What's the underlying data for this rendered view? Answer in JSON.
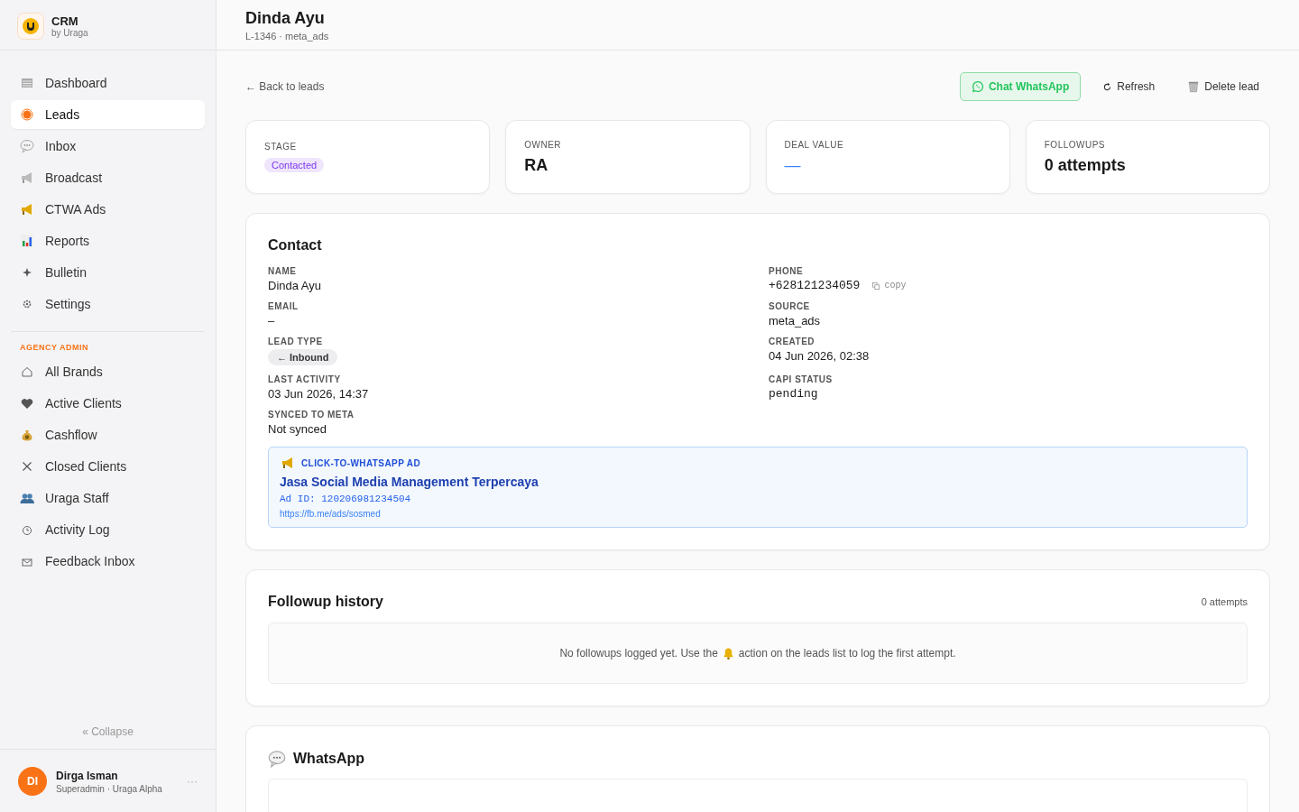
{
  "brand": {
    "name": "CRM",
    "subtitle": "by Uraga"
  },
  "nav": [
    {
      "label": "Dashboard",
      "selected": false
    },
    {
      "label": "Leads",
      "selected": true
    },
    {
      "label": "Inbox",
      "selected": false
    },
    {
      "label": "Broadcast",
      "selected": false
    },
    {
      "label": "CTWA Ads",
      "selected": false
    },
    {
      "label": "Reports",
      "selected": false
    },
    {
      "label": "Bulletin",
      "selected": false
    },
    {
      "label": "Settings",
      "selected": false
    }
  ],
  "admin_section": {
    "heading": "AGENCY ADMIN",
    "items": [
      {
        "label": "All Brands",
        "selected": false
      },
      {
        "label": "Active Clients",
        "selected": false
      },
      {
        "label": "Cashflow",
        "selected": false
      },
      {
        "label": "Closed Clients",
        "selected": false
      },
      {
        "label": "Uraga Staff",
        "selected": false
      },
      {
        "label": "Activity Log",
        "selected": false
      },
      {
        "label": "Feedback Inbox",
        "selected": false
      }
    ]
  },
  "collapse": "« Collapse",
  "user": {
    "initials": "DI",
    "name": "Dirga Isman",
    "role": "Superadmin · Uraga Alpha",
    "menu": "···"
  },
  "header": {
    "title": "Dinda Ayu",
    "subtitle": "L-1346 · meta_ads"
  },
  "back_link": "← Back to leads",
  "actions": [
    {
      "label": "Chat WhatsApp",
      "kind": "primary"
    },
    {
      "label": "Refresh",
      "kind": "refresh"
    },
    {
      "label": "Delete lead",
      "kind": "delete"
    }
  ],
  "stats": [
    {
      "label": "STAGE",
      "kind": "badge",
      "value": "Contacted"
    },
    {
      "label": "OWNER",
      "kind": "text",
      "value": "RA"
    },
    {
      "label": "DEAL VALUE",
      "kind": "empty",
      "value": "—"
    },
    {
      "label": "FOLLOWUPS",
      "kind": "text",
      "value": "0 attempts"
    }
  ],
  "contact": {
    "title": "Contact",
    "fields": [
      {
        "label": "NAME",
        "kind": "text",
        "value": "Dinda Ayu"
      },
      {
        "label": "PHONE",
        "kind": "phone",
        "value": "+628121234059",
        "action": "copy"
      },
      {
        "label": "EMAIL",
        "kind": "text",
        "value": "–"
      },
      {
        "label": "SOURCE",
        "kind": "text",
        "value": "meta_ads"
      },
      {
        "label": "LEAD TYPE",
        "kind": "pill",
        "value": "← Inbound"
      },
      {
        "label": "CREATED",
        "kind": "text",
        "value": "04 Jun 2026, 02:38"
      },
      {
        "label": "LAST ACTIVITY",
        "kind": "text",
        "value": "03 Jun 2026, 14:37"
      },
      {
        "label": "CAPI STATUS",
        "kind": "mono",
        "value": "pending"
      },
      {
        "label": "SYNCED TO META",
        "kind": "text",
        "value": "Not synced"
      }
    ]
  },
  "ad": {
    "heading": "CLICK-TO-WHATSAPP AD",
    "title": "Jasa Social Media Management Terpercaya",
    "ad_id": "Ad ID: 120206981234504",
    "url": "https://fb.me/ads/sosmed"
  },
  "followups": {
    "title": "Followup history",
    "count": "0 attempts",
    "empty_before": "No followups logged yet. Use the",
    "empty_after": "action on the leads list to log the first attempt."
  },
  "whatsapp": {
    "title": "WhatsApp"
  }
}
